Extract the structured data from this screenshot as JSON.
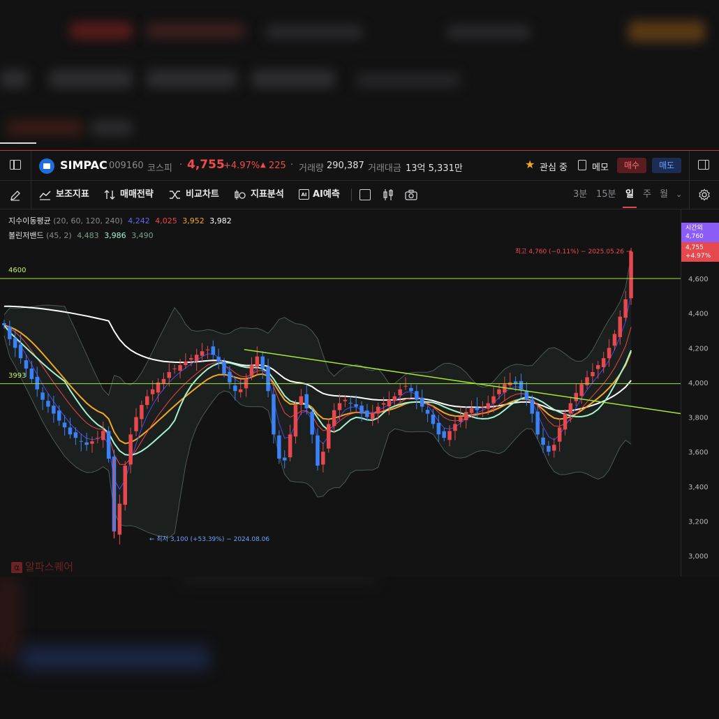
{
  "header": {
    "name": "SIMPAC",
    "code": "009160",
    "market": "코스피",
    "dot": "·",
    "price": "4,755",
    "change_pct": "+4.97%",
    "change_arrow": "▲",
    "change_abs": "225",
    "volume_label": "거래량",
    "volume": "290,387",
    "value_label": "거래대금",
    "value": "13억 5,331만",
    "watch_label": "관심 중",
    "memo_label": "메모",
    "buy_label": "매수",
    "sell_label": "매도"
  },
  "toolbar": {
    "items": [
      "보조지표",
      "매매전략",
      "비교차트",
      "지표분석",
      "AI예측"
    ],
    "timeframes": [
      "3분",
      "15분",
      "일",
      "주",
      "월"
    ],
    "active_timeframe": "일"
  },
  "legend": {
    "ma_label": "지수이동평균",
    "ma_params": "(20, 60, 120, 240)",
    "ma_values": [
      "4,242",
      "4,025",
      "3,952",
      "3,982"
    ],
    "bb_label": "볼린저밴드",
    "bb_params": "(45, 2)",
    "bb_values": [
      "4,483",
      "3,986",
      "3,490"
    ]
  },
  "chart": {
    "hline_labels": [
      "4600",
      "3993"
    ],
    "badge_time_label": "시간외",
    "badge_time_value": "4,760",
    "badge_price": "4,755",
    "badge_pct": "+4.97%",
    "high_annotation": "최고 4,760 (−0.11%) − 2025.05.26 →",
    "low_annotation": "← 최저 3,100 (+53.39%) − 2024.08.06",
    "watermark": "알파스퀘어",
    "watermark_icon": "α"
  },
  "chart_data": {
    "type": "candlestick",
    "y_axis_ticks": [
      "4,600",
      "4,400",
      "4,200",
      "4,000",
      "3,800",
      "3,600",
      "3,400",
      "3,200",
      "3,000"
    ],
    "ylim": [
      2980,
      4820
    ],
    "up_color": "#e5484d",
    "down_color": "#3b82f6",
    "horizontal_lines": [
      4600,
      3993
    ],
    "period_high": {
      "value": 4760,
      "date": "2025.05.26"
    },
    "period_low": {
      "value": 3100,
      "date": "2024.08.06"
    },
    "close_series_approx": [
      4330,
      4250,
      4200,
      4140,
      4080,
      4020,
      3960,
      3900,
      3860,
      3820,
      3780,
      3740,
      3700,
      3680,
      3660,
      3640,
      3660,
      3680,
      3720,
      3560,
      3140,
      3300,
      3520,
      3700,
      3800,
      3870,
      3920,
      3960,
      4000,
      4020,
      4060,
      4080,
      4100,
      4120,
      4140,
      4160,
      4180,
      4190,
      4160,
      4120,
      4050,
      4000,
      3950,
      3960,
      4020,
      4100,
      4150,
      4080,
      3950,
      3700,
      3560,
      3550,
      3700,
      3870,
      3920,
      3850,
      3700,
      3520,
      3600,
      3760,
      3840,
      3880,
      3900,
      3880,
      3860,
      3820,
      3800,
      3820,
      3860,
      3880,
      3900,
      3920,
      3960,
      3980,
      3950,
      3900,
      3860,
      3820,
      3760,
      3700,
      3680,
      3720,
      3760,
      3800,
      3830,
      3850,
      3840,
      3860,
      3880,
      3920,
      3960,
      3990,
      4000,
      3990,
      3960,
      3900,
      3820,
      3700,
      3640,
      3600,
      3640,
      3740,
      3820,
      3880,
      3940,
      3990,
      4030,
      4060,
      4100,
      4140,
      4200,
      4280,
      4380,
      4480,
      4755
    ]
  },
  "colors": {
    "up": "#e5484d",
    "down": "#3b82f6",
    "ma20": "#4f46e5",
    "ma60": "#ef4444",
    "ma120": "#f5a623",
    "ma240": "#ffffff",
    "bb_mid": "#a7f3d0",
    "trendline": "#a3e635"
  }
}
